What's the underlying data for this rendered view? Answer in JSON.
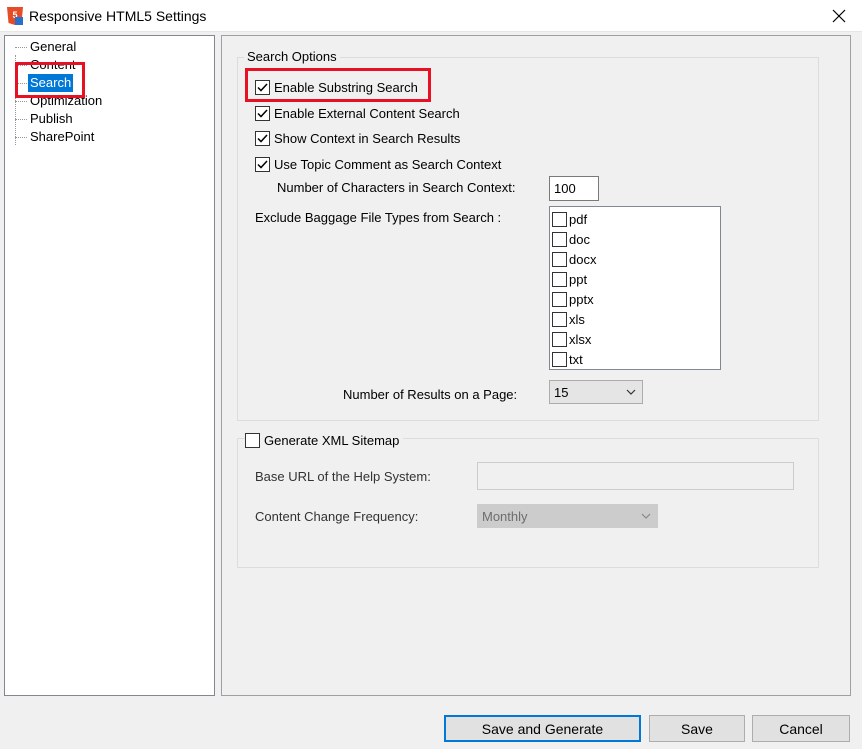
{
  "window": {
    "title": "Responsive HTML5 Settings",
    "icon": "html5-app-icon"
  },
  "nav": {
    "items": [
      {
        "label": "General",
        "selected": false
      },
      {
        "label": "Content",
        "selected": false
      },
      {
        "label": "Search",
        "selected": true
      },
      {
        "label": "Optimization",
        "selected": false
      },
      {
        "label": "Publish",
        "selected": false
      },
      {
        "label": "SharePoint",
        "selected": false
      }
    ]
  },
  "search_options": {
    "title": "Search Options",
    "enable_substring": {
      "label": "Enable Substring Search",
      "checked": true
    },
    "enable_external": {
      "label": "Enable External Content Search",
      "checked": true
    },
    "show_context": {
      "label": "Show Context in Search Results",
      "checked": true
    },
    "use_topic_comment": {
      "label": "Use Topic Comment as Search Context",
      "checked": true
    },
    "num_chars_label": "Number of Characters in Search Context:",
    "num_chars_value": "100",
    "exclude_label": "Exclude Baggage File Types from Search :",
    "file_types": [
      {
        "label": "pdf",
        "checked": false
      },
      {
        "label": "doc",
        "checked": false
      },
      {
        "label": "docx",
        "checked": false
      },
      {
        "label": "ppt",
        "checked": false
      },
      {
        "label": "pptx",
        "checked": false
      },
      {
        "label": "xls",
        "checked": false
      },
      {
        "label": "xlsx",
        "checked": false
      },
      {
        "label": "txt",
        "checked": false
      }
    ],
    "results_per_page_label": "Number of Results on a Page:",
    "results_per_page_value": "15"
  },
  "sitemap": {
    "generate": {
      "label": "Generate XML Sitemap",
      "checked": false
    },
    "base_url_label": "Base URL of the Help System:",
    "base_url_value": "",
    "frequency_label": "Content Change Frequency:",
    "frequency_value": "Monthly"
  },
  "buttons": {
    "save_generate": "Save and Generate",
    "save": "Save",
    "cancel": "Cancel"
  },
  "colors": {
    "selection": "#0078d7",
    "highlight": "#e81123"
  }
}
